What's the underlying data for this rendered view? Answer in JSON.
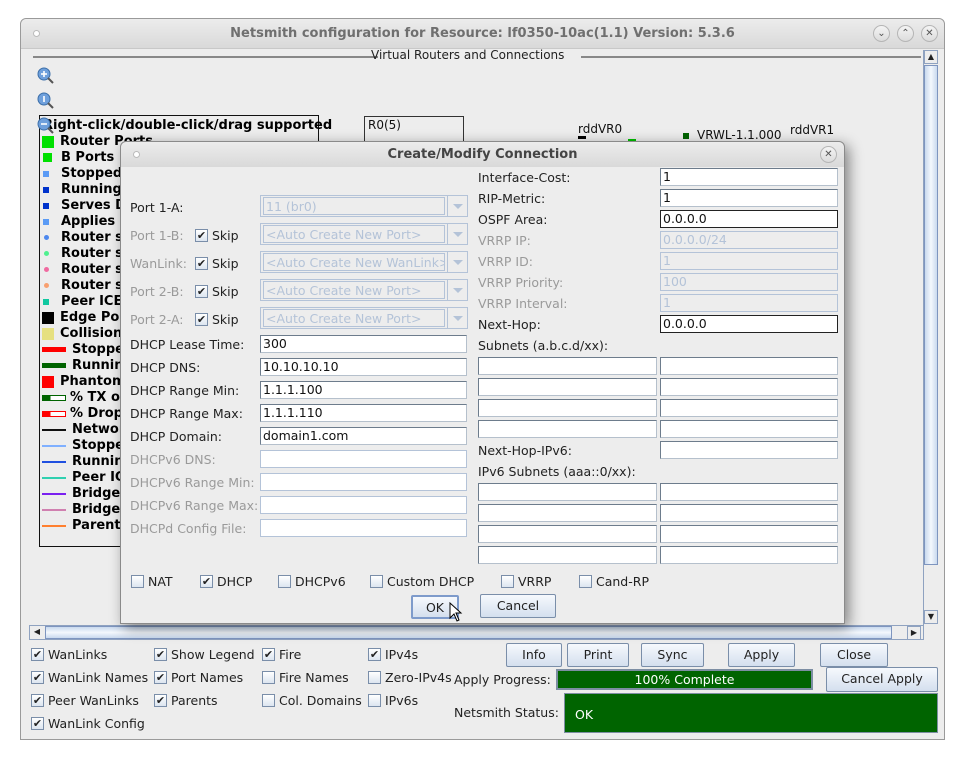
{
  "window": {
    "title": "Netsmith configuration for Resource:  lf0350-10ac(1.1)  Version: 5.3.6",
    "group_title": "Virtual Routers and Connections"
  },
  "canvas": {
    "legend_header": "Right-click/double-click/drag supported",
    "legend": [
      {
        "label": "Router Ports",
        "color": "#00e000",
        "shape": "square-lg"
      },
      {
        "label": "B Ports",
        "color": "#00e000",
        "shape": "square"
      },
      {
        "label": "Stopped",
        "color": "#5b9bf5",
        "shape": "square-sm"
      },
      {
        "label": "Running",
        "color": "#0033cc",
        "shape": "square-sm"
      },
      {
        "label": "Serves DHCP",
        "color": "#0033cc",
        "shape": "square-sm"
      },
      {
        "label": "Applies NAT",
        "color": "#5b9bf5",
        "shape": "square-sm"
      },
      {
        "label": "Router subnet",
        "color": "#4d88ee",
        "shape": "dot"
      },
      {
        "label": "Router subnet",
        "color": "#50f090",
        "shape": "dot"
      },
      {
        "label": "Router subnet",
        "color": "#f06aa0",
        "shape": "dot"
      },
      {
        "label": "Router subnet",
        "color": "#f8a070",
        "shape": "dot"
      },
      {
        "label": "Peer ICE",
        "color": "#10c8a0",
        "shape": "square-sm"
      },
      {
        "label": "Edge Port",
        "color": "#000000",
        "shape": "square-lg"
      },
      {
        "label": "Collision Domain",
        "color": "#e6e080",
        "shape": "square-lg"
      },
      {
        "label": "Stopped",
        "color": "#ff0000",
        "shape": "bar"
      },
      {
        "label": "Running",
        "color": "#006400",
        "shape": "bar"
      },
      {
        "label": "Phantom",
        "color": "#ff0000",
        "shape": "square-lg"
      },
      {
        "label": "% TX over",
        "color": "#006400",
        "shape": "partial-bar"
      },
      {
        "label": "% Dropped",
        "color": "#ff0000",
        "shape": "partial-bar"
      },
      {
        "label": "Network",
        "color": "#111111",
        "shape": "line"
      },
      {
        "label": "Stopped",
        "color": "#80b0ff",
        "shape": "line"
      },
      {
        "label": "Running",
        "color": "#2050e0",
        "shape": "line"
      },
      {
        "label": "Peer ICE",
        "color": "#30d0b0",
        "shape": "line"
      },
      {
        "label": "Bridge",
        "color": "#7a20f0",
        "shape": "line"
      },
      {
        "label": "Bridge",
        "color": "#d080b0",
        "shape": "line"
      },
      {
        "label": "Parent/",
        "color": "#ff8030",
        "shape": "line"
      }
    ],
    "router_box_label": "R0(5)",
    "node_labels": [
      "rddVR0",
      "VRWL-1.1.000",
      "rddVR1"
    ],
    "zoom_icons": [
      "zoom-in-icon",
      "zoom-reset-icon",
      "zoom-out-icon"
    ]
  },
  "dialog": {
    "title": "Create/Modify Connection",
    "left": {
      "port1a": {
        "label": "Port 1-A:",
        "value": "11 (br0)"
      },
      "port1b": {
        "label": "Port 1-B:",
        "skip": "Skip",
        "value": "<Auto Create New Port>"
      },
      "wanlink": {
        "label": "WanLink:",
        "skip": "Skip",
        "value": "<Auto Create New WanLink>"
      },
      "port2b": {
        "label": "Port 2-B:",
        "skip": "Skip",
        "value": "<Auto Create New Port>"
      },
      "port2a": {
        "label": "Port 2-A:",
        "skip": "Skip",
        "value": "<Auto Create New Port>"
      },
      "dhcp_lease": {
        "label": "DHCP Lease Time:",
        "value": "300"
      },
      "dhcp_dns": {
        "label": "DHCP DNS:",
        "value": "10.10.10.10"
      },
      "dhcp_min": {
        "label": "DHCP Range Min:",
        "value": "1.1.1.100"
      },
      "dhcp_max": {
        "label": "DHCP Range Max:",
        "value": "1.1.1.110"
      },
      "dhcp_domain": {
        "label": "DHCP Domain:",
        "value": "domain1.com"
      },
      "dhcpv6_dns": {
        "label": "DHCPv6 DNS:",
        "value": ""
      },
      "dhcpv6_min": {
        "label": "DHCPv6 Range Min:",
        "value": ""
      },
      "dhcpv6_max": {
        "label": "DHCPv6 Range Max:",
        "value": ""
      },
      "dhcpd_cfg": {
        "label": "DHCPd Config File:",
        "value": ""
      }
    },
    "right": {
      "iface_cost": {
        "label": "Interface-Cost:",
        "value": "1"
      },
      "rip_metric": {
        "label": "RIP-Metric:",
        "value": "1"
      },
      "ospf_area": {
        "label": "OSPF Area:",
        "value": "0.0.0.0"
      },
      "vrrp_ip": {
        "label": "VRRP IP:",
        "value": "0.0.0.0/24"
      },
      "vrrp_id": {
        "label": "VRRP ID:",
        "value": "1"
      },
      "vrrp_prio": {
        "label": "VRRP Priority:",
        "value": "100"
      },
      "vrrp_int": {
        "label": "VRRP Interval:",
        "value": "1"
      },
      "next_hop": {
        "label": "Next-Hop:",
        "value": "0.0.0.0"
      },
      "subnets_label": "Subnets (a.b.c.d/xx):",
      "subnets": [
        "",
        "",
        "",
        "",
        "",
        "",
        "",
        ""
      ],
      "next_hop_v6": {
        "label": "Next-Hop-IPv6:",
        "value": ""
      },
      "ipv6_subnets_label": "IPv6 Subnets (aaa::0/xx):",
      "ipv6_subnets": [
        "",
        "",
        "",
        "",
        "",
        "",
        "",
        ""
      ]
    },
    "options": [
      {
        "label": "NAT",
        "checked": false
      },
      {
        "label": "DHCP",
        "checked": true
      },
      {
        "label": "DHCPv6",
        "checked": false
      },
      {
        "label": "Custom DHCP",
        "checked": false
      },
      {
        "label": "VRRP",
        "checked": false
      },
      {
        "label": "Cand-RP",
        "checked": false
      }
    ],
    "ok_label": "OK",
    "cancel_label": "Cancel"
  },
  "bottom": {
    "checkboxes": [
      {
        "label": "WanLinks",
        "checked": true
      },
      {
        "label": "WanLink Names",
        "checked": true
      },
      {
        "label": "Peer WanLinks",
        "checked": true
      },
      {
        "label": "WanLink Config",
        "checked": true
      },
      {
        "label": "Show Legend",
        "checked": true
      },
      {
        "label": "Port Names",
        "checked": true
      },
      {
        "label": "Parents",
        "checked": true
      },
      {
        "label": "Fire",
        "checked": true
      },
      {
        "label": "Fire Names",
        "checked": false
      },
      {
        "label": "Col. Domains",
        "checked": false
      },
      {
        "label": "IPv4s",
        "checked": true
      },
      {
        "label": "Zero-IPv4s",
        "checked": false
      },
      {
        "label": "IPv6s",
        "checked": false
      }
    ],
    "buttons": {
      "info": "Info",
      "print": "Print",
      "sync": "Sync",
      "apply": "Apply",
      "close": "Close",
      "cancel_apply": "Cancel Apply"
    },
    "apply_progress_label": "Apply Progress:",
    "apply_progress_text": "100% Complete",
    "apply_progress_percent": 100,
    "status_label": "Netsmith Status:",
    "status_text": "OK",
    "status_color": "#006400"
  },
  "check_glyph": "✔"
}
